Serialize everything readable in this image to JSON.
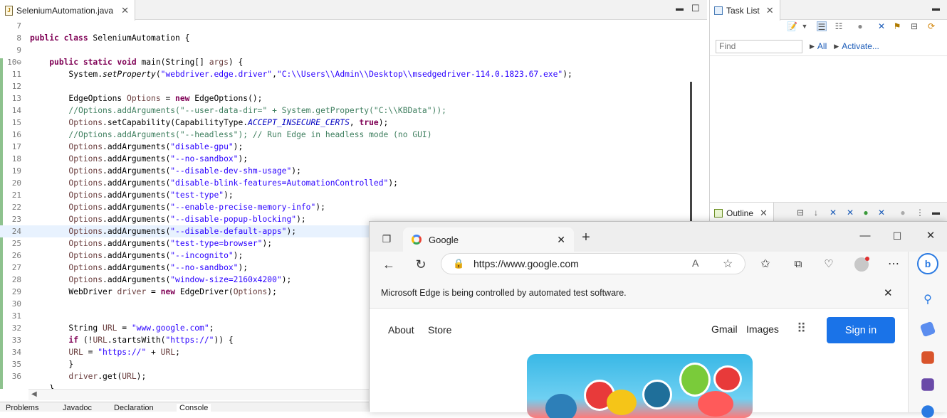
{
  "editor": {
    "tab_title": "SeleniumAutomation.java",
    "lines": [
      {
        "n": "7",
        "h": ""
      },
      {
        "n": "8",
        "h": "<span class=\"kw\">public class</span> SeleniumAutomation {"
      },
      {
        "n": "9",
        "h": ""
      },
      {
        "n": "10⊖",
        "h": "    <span class=\"kw\">public static void</span> main(String[] <span class=\"var\">args</span>) {"
      },
      {
        "n": "11",
        "h": "        System.<span class=\"mth\">setProperty</span>(<span class=\"str\">\"webdriver.edge.driver\"</span>,<span class=\"str\">\"C:\\\\Users\\\\Admin\\\\Desktop\\\\msedgedriver-114.0.1823.67.exe\"</span>);"
      },
      {
        "n": "12",
        "h": ""
      },
      {
        "n": "13",
        "h": "        EdgeOptions <span class=\"var\">Options</span> = <span class=\"kw\">new</span> EdgeOptions();"
      },
      {
        "n": "14",
        "h": "        <span class=\"cm\">//Options.addArguments(\"--user-data-dir=\" + System.getProperty(\"C:\\\\KBData\"));</span>"
      },
      {
        "n": "15",
        "h": "        <span class=\"var\">Options</span>.setCapability(CapabilityType.<span class=\"cst\">ACCEPT_INSECURE_CERTS</span>, <span class=\"kw\">true</span>);"
      },
      {
        "n": "16",
        "h": "        <span class=\"cm\">//Options.addArguments(\"--headless\"); // Run Edge in headless mode (no GUI)</span>"
      },
      {
        "n": "17",
        "h": "        <span class=\"var\">Options</span>.addArguments(<span class=\"str\">\"disable-gpu\"</span>);"
      },
      {
        "n": "18",
        "h": "        <span class=\"var\">Options</span>.addArguments(<span class=\"str\">\"--no-sandbox\"</span>);"
      },
      {
        "n": "19",
        "h": "        <span class=\"var\">Options</span>.addArguments(<span class=\"str\">\"--disable-dev-shm-usage\"</span>);"
      },
      {
        "n": "20",
        "h": "        <span class=\"var\">Options</span>.addArguments(<span class=\"str\">\"disable-blink-features=AutomationControlled\"</span>);"
      },
      {
        "n": "21",
        "h": "        <span class=\"var\">Options</span>.addArguments(<span class=\"str\">\"test-type\"</span>);"
      },
      {
        "n": "22",
        "h": "        <span class=\"var\">Options</span>.addArguments(<span class=\"str\">\"--enable-precise-memory-info\"</span>);"
      },
      {
        "n": "23",
        "h": "        <span class=\"var\">Options</span>.addArguments(<span class=\"str\">\"--disable-popup-blocking\"</span>);"
      },
      {
        "n": "24",
        "h": "        <span class=\"var\">Options</span>.addArguments(<span class=\"str\">\"--disable-default-apps\"</span>);"
      },
      {
        "n": "25",
        "h": "        <span class=\"var\">Options</span>.addArguments(<span class=\"str\">\"test-type=browser\"</span>);"
      },
      {
        "n": "26",
        "h": "        <span class=\"var\">Options</span>.addArguments(<span class=\"str\">\"--incognito\"</span>);"
      },
      {
        "n": "27",
        "h": "        <span class=\"var\">Options</span>.addArguments(<span class=\"str\">\"--no-sandbox\"</span>);"
      },
      {
        "n": "28",
        "h": "        <span class=\"var\">Options</span>.addArguments(<span class=\"str\">\"window-size=2160x4200\"</span>);"
      },
      {
        "n": "29",
        "h": "        WebDriver <span class=\"var\">driver</span> = <span class=\"kw\">new</span> EdgeDriver(<span class=\"var\">Options</span>);"
      },
      {
        "n": "30",
        "h": ""
      },
      {
        "n": "31",
        "h": ""
      },
      {
        "n": "32",
        "h": "        String <span class=\"var\">URL</span> = <span class=\"str\">\"www.google.com\"</span>;"
      },
      {
        "n": "33",
        "h": "        <span class=\"kw\">if</span> (!<span class=\"var\">URL</span>.startsWith(<span class=\"str\">\"https://\"</span>)) {"
      },
      {
        "n": "34",
        "h": "        <span class=\"var\">URL</span> = <span class=\"str\">\"https://\"</span> + <span class=\"var\">URL</span>;"
      },
      {
        "n": "35",
        "h": "        }"
      },
      {
        "n": "36",
        "h": "        <span class=\"var\">driver</span>.get(<span class=\"var\">URL</span>);"
      },
      {
        "n": "",
        "h": "    }"
      }
    ],
    "bottom_tabs": [
      "Problems",
      "Javadoc",
      "Declaration",
      "Console"
    ]
  },
  "task_list": {
    "title": "Task List",
    "find_placeholder": "Find",
    "all_label": "All",
    "activate_label": "Activate..."
  },
  "outline": {
    "title": "Outline"
  },
  "browser": {
    "tab_title": "Google",
    "url": "https://www.google.com",
    "banner_text": "Microsoft Edge is being controlled by automated test software.",
    "nav_about": "About",
    "nav_store": "Store",
    "nav_gmail": "Gmail",
    "nav_images": "Images",
    "signin_label": "Sign in"
  }
}
